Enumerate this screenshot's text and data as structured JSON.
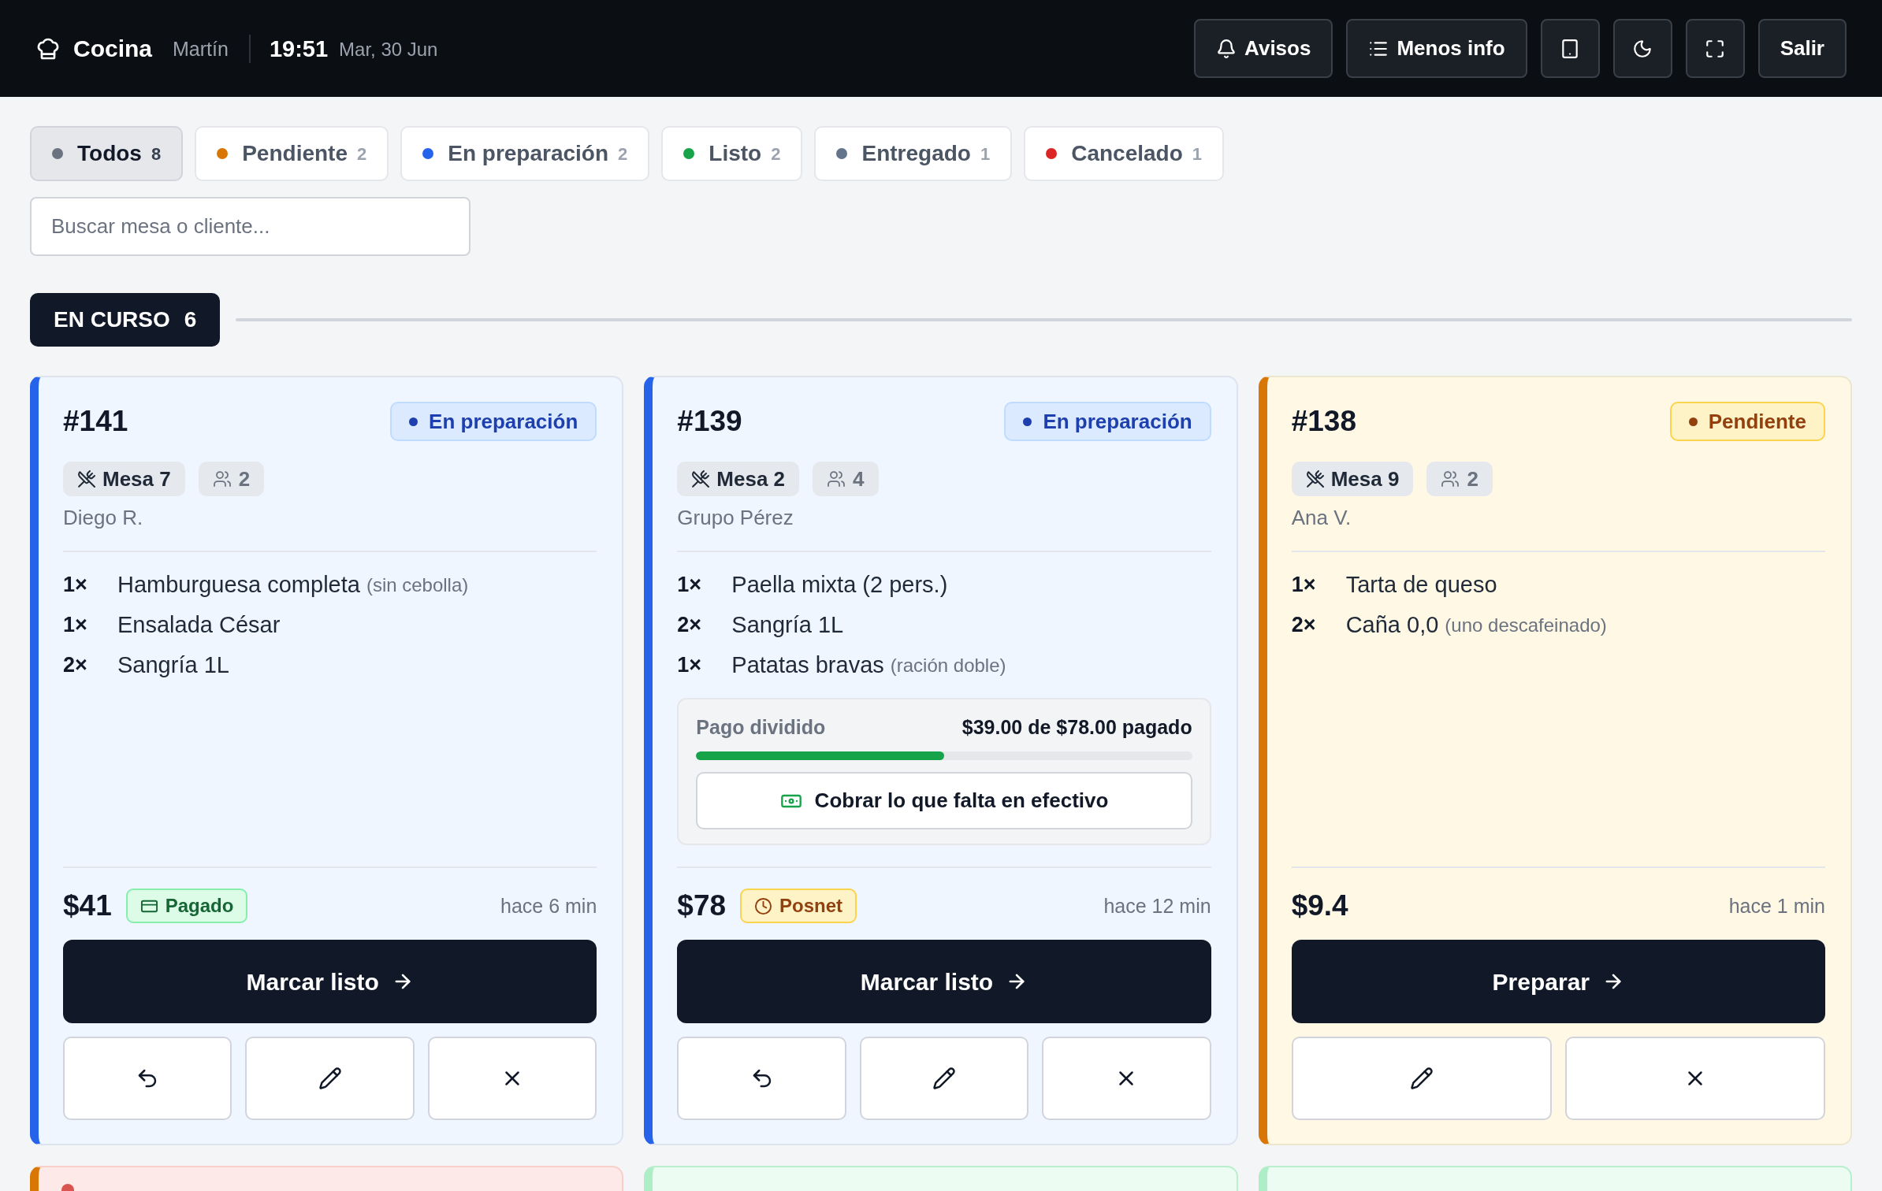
{
  "header": {
    "title": "Cocina",
    "user": "Martín",
    "time": "19:51",
    "date": "Mar, 30 Jun",
    "buttons": [
      {
        "kind": "notifications",
        "label": "Avisos"
      },
      {
        "kind": "details",
        "label": "Menos info"
      },
      {
        "kind": "tablet"
      },
      {
        "kind": "theme"
      },
      {
        "kind": "fullscreen"
      },
      {
        "kind": "logout",
        "label": "Salir"
      }
    ]
  },
  "filters": [
    {
      "label": "Todos",
      "count": "8",
      "color": "#6b7280",
      "selected": true
    },
    {
      "label": "Pendiente",
      "count": "2",
      "color": "#d97706",
      "selected": false
    },
    {
      "label": "En preparación",
      "count": "2",
      "color": "#2563eb",
      "selected": false
    },
    {
      "label": "Listo",
      "count": "2",
      "color": "#16a34a",
      "selected": false
    },
    {
      "label": "Entregado",
      "count": "1",
      "color": "#64748b",
      "selected": false
    },
    {
      "label": "Cancelado",
      "count": "1",
      "color": "#dc2626",
      "selected": false
    }
  ],
  "search": {
    "placeholder": "Buscar mesa o cliente..."
  },
  "section": {
    "label": "EN CURSO",
    "count": "6"
  },
  "orders": [
    {
      "number": "#141",
      "status": {
        "kind": "preparing",
        "label": "En preparación"
      },
      "table": "Mesa 7",
      "guests": "2",
      "customer": "Diego R.",
      "items": [
        {
          "qty": "1×",
          "name": "Hamburguesa completa",
          "note": "(sin cebolla)"
        },
        {
          "qty": "1×",
          "name": "Ensalada César"
        },
        {
          "qty": "2×",
          "name": "Sangría 1L"
        }
      ],
      "total": "$41",
      "payment": {
        "kind": "paid",
        "label": "Pagado"
      },
      "age": "hace 6 min",
      "primary_action": "Marcar listo",
      "secondary_actions": [
        {
          "kind": "undo"
        },
        {
          "kind": "edit"
        },
        {
          "kind": "cancel"
        }
      ]
    },
    {
      "number": "#139",
      "status": {
        "kind": "preparing",
        "label": "En preparación"
      },
      "table": "Mesa 2",
      "guests": "4",
      "customer": "Grupo Pérez",
      "items": [
        {
          "qty": "1×",
          "name": "Paella mixta (2 pers.)"
        },
        {
          "qty": "2×",
          "name": "Sangría 1L"
        },
        {
          "qty": "1×",
          "name": "Patatas bravas",
          "note": "(ración doble)"
        }
      ],
      "split": {
        "label": "Pago dividido",
        "summary": "$39.00 de $78.00 pagado",
        "level": 0.5,
        "action": "Cobrar lo que falta en efectivo"
      },
      "total": "$78",
      "payment": {
        "kind": "posnet",
        "label": "Posnet"
      },
      "age": "hace 12 min",
      "primary_action": "Marcar listo",
      "secondary_actions": [
        {
          "kind": "undo"
        },
        {
          "kind": "edit"
        },
        {
          "kind": "cancel"
        }
      ]
    },
    {
      "number": "#138",
      "status": {
        "kind": "pending",
        "label": "Pendiente"
      },
      "table": "Mesa 9",
      "guests": "2",
      "customer": "Ana V.",
      "items": [
        {
          "qty": "1×",
          "name": "Tarta de queso"
        },
        {
          "qty": "2×",
          "name": "Caña 0,0",
          "note": "(uno descafeinado)"
        }
      ],
      "total": "$9.4",
      "age": "hace 1 min",
      "primary_action": "Preparar",
      "secondary_actions": [
        {
          "kind": "edit"
        },
        {
          "kind": "cancel"
        }
      ]
    }
  ],
  "more_orders": [
    {
      "kind": "alert"
    },
    {
      "kind": "ready"
    },
    {
      "kind": "ready"
    }
  ]
}
